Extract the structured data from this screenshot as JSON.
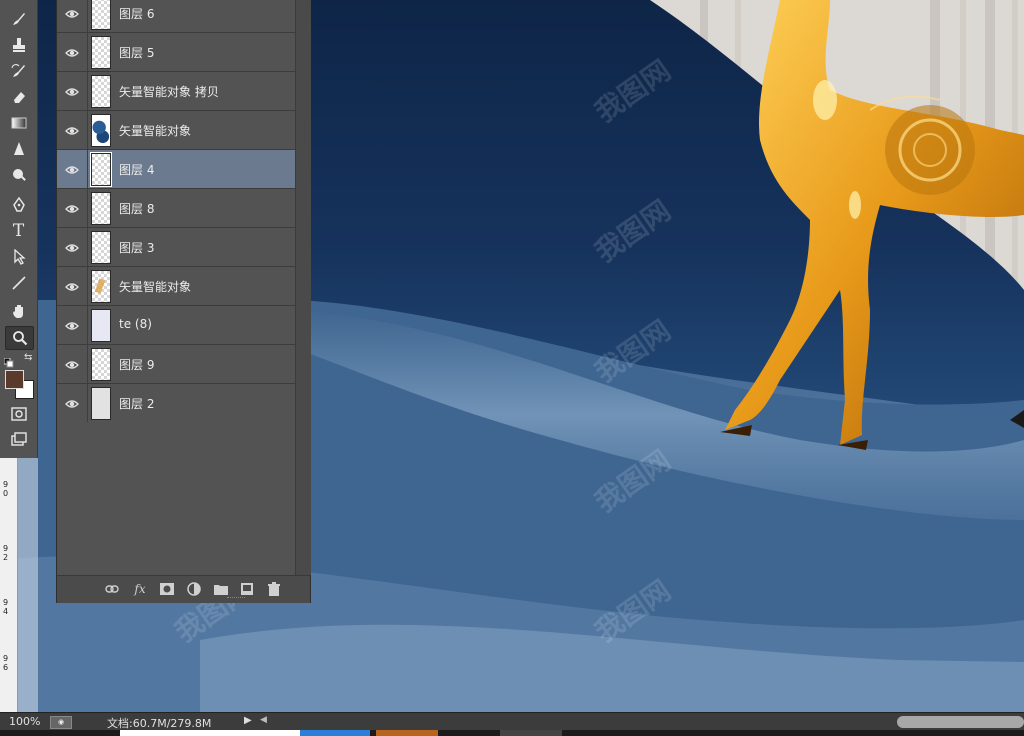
{
  "layers_panel": {
    "layers": [
      {
        "name": "图层 6",
        "visible": true,
        "selected": false,
        "thumb": "transparent"
      },
      {
        "name": "图层 5",
        "visible": true,
        "selected": false,
        "thumb": "transparent"
      },
      {
        "name": "矢量智能对象 拷贝",
        "visible": true,
        "selected": false,
        "thumb": "transparent"
      },
      {
        "name": "矢量智能对象",
        "visible": true,
        "selected": false,
        "thumb": "blue"
      },
      {
        "name": "图层 4",
        "visible": true,
        "selected": true,
        "thumb": "transparent"
      },
      {
        "name": "图层 8",
        "visible": true,
        "selected": false,
        "thumb": "transparent"
      },
      {
        "name": "图层 3",
        "visible": true,
        "selected": false,
        "thumb": "transparent"
      },
      {
        "name": "矢量智能对象",
        "visible": true,
        "selected": false,
        "thumb": "gold"
      },
      {
        "name": "te (8)",
        "visible": true,
        "selected": false,
        "thumb": "pale"
      },
      {
        "name": "图层 9",
        "visible": true,
        "selected": false,
        "thumb": "transparent"
      },
      {
        "name": "图层 2",
        "visible": true,
        "selected": false,
        "thumb": "solid"
      }
    ],
    "footer_icons": [
      "link-icon",
      "fx-icon",
      "mask-icon",
      "adjustment-icon",
      "folder-icon",
      "new-layer-icon",
      "trash-icon"
    ],
    "fx_label": "fx"
  },
  "toolbar": {
    "tools": [
      "brush-tool",
      "clone-stamp-tool",
      "history-brush-tool",
      "eraser-tool",
      "gradient-tool",
      "blur-tool",
      "dodge-tool",
      "pen-tool",
      "type-tool",
      "path-selection-tool",
      "line-tool",
      "hand-tool",
      "zoom-tool"
    ],
    "type_tool_label": "T",
    "active_tool": "zoom-tool",
    "foreground_color": "#5a3a2a",
    "background_color": "#ffffff"
  },
  "ruler": {
    "labels": [
      "9 0",
      "9 2",
      "9 4",
      "9 6"
    ]
  },
  "status_bar": {
    "zoom": "100%",
    "doc_info": "文档:60.7M/279.8M"
  },
  "canvas": {
    "watermark_text": "我图网",
    "background_color": "#2a4f7e",
    "deer_color": "#e89a1a"
  },
  "taskbar": {
    "colors": [
      "#ffffff",
      "#2b7fd8",
      "#b7651e",
      "#444444"
    ]
  }
}
